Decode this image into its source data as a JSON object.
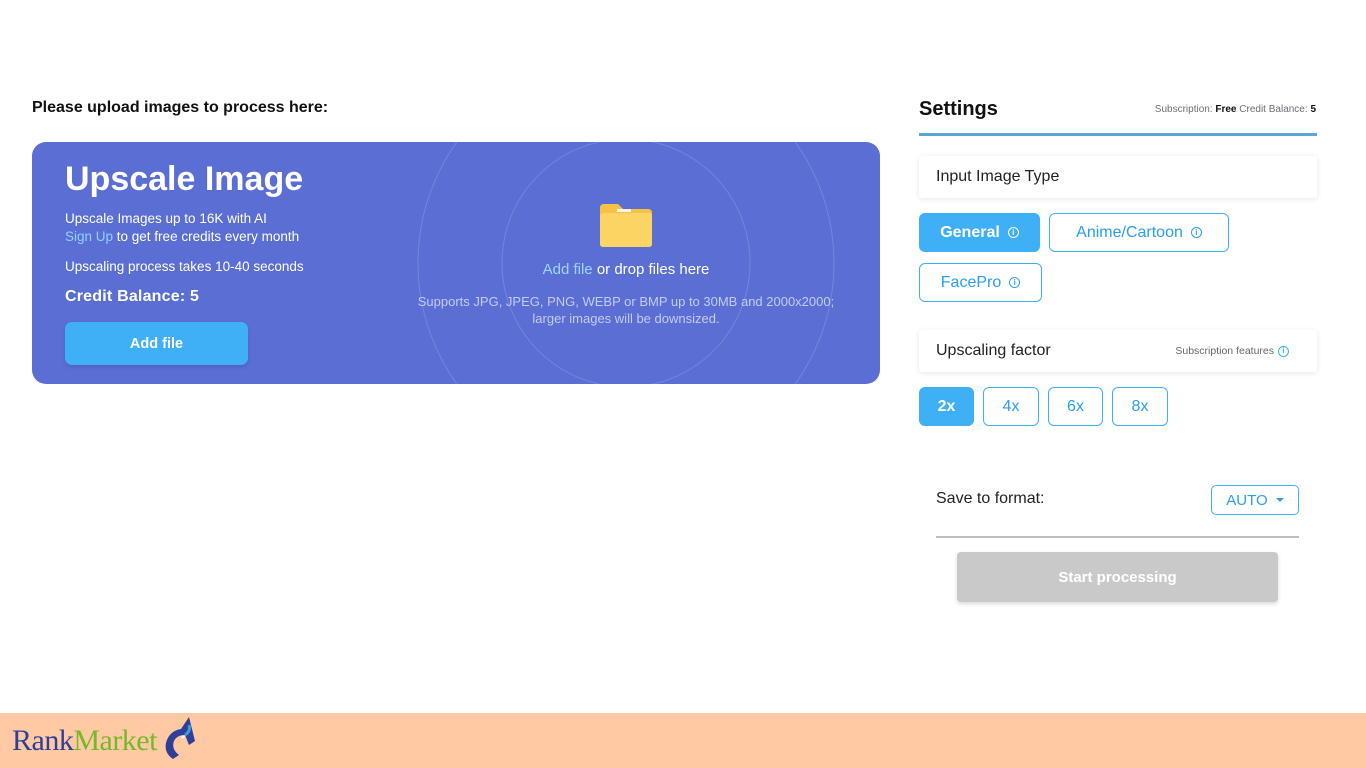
{
  "upload": {
    "heading": "Please upload images to process here:"
  },
  "hero": {
    "title": "Upscale Image",
    "line1": "Upscale Images up to 16K with AI",
    "signup_link": "Sign Up",
    "line2_rest": " to get free credits every month",
    "line3": "Upscaling process takes 10-40 seconds",
    "credit": "Credit Balance: 5",
    "add_button": "Add file"
  },
  "dropzone": {
    "add_link": "Add file",
    "drop_text": " or drop files here",
    "supports": "Supports JPG, JPEG, PNG, WEBP or BMP up to 30MB and 2000x2000;",
    "downsize": "larger images will be downsized."
  },
  "settings": {
    "title": "Settings",
    "subscription_label": "Subscription:",
    "subscription_value": "Free",
    "credit_label": "Credit Balance:",
    "credit_value": "5",
    "input_type_title": "Input Image Type",
    "image_types": [
      {
        "label": "General",
        "active": true
      },
      {
        "label": "Anime/Cartoon",
        "active": false
      },
      {
        "label": "FacePro",
        "active": false
      }
    ],
    "upscale_title": "Upscaling factor",
    "subscription_features": "Subscription features",
    "factors": [
      {
        "label": "2x",
        "active": true
      },
      {
        "label": "4x",
        "active": false
      },
      {
        "label": "6x",
        "active": false
      },
      {
        "label": "8x",
        "active": false
      }
    ],
    "save_label": "Save to format:",
    "format_value": "AUTO",
    "start_button": "Start processing",
    "info_glyph": "i"
  },
  "footer": {
    "brand_rank": "Rank",
    "brand_market": "Market"
  },
  "colors": {
    "hero_bg": "#5b6ed4",
    "accent": "#40b0f6",
    "footer_bg": "#ffc9a3",
    "disabled": "#c9c9c9"
  }
}
